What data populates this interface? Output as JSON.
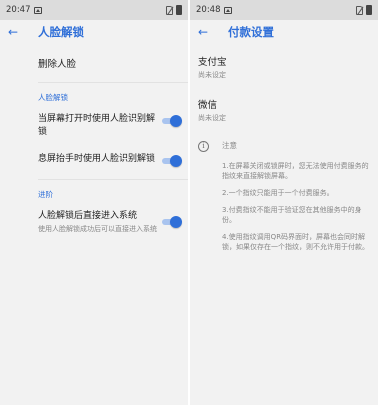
{
  "left": {
    "status": {
      "time": "20:47"
    },
    "title": "人脸解锁",
    "delete_label": "删除人脸",
    "section1": "人脸解锁",
    "toggle1": "当屏幕打开时使用人脸识别解锁",
    "toggle2": "息屏抬手时使用人脸识别解锁",
    "section2": "进阶",
    "toggle3": "人脸解锁后直接进入系统",
    "toggle3_sub": "使用人脸解锁成功后可以直接进入系统"
  },
  "right": {
    "status": {
      "time": "20:48"
    },
    "title": "付款设置",
    "items": [
      {
        "title": "支付宝",
        "subtitle": "尚未设定"
      },
      {
        "title": "微信",
        "subtitle": "尚未设定"
      }
    ],
    "note_title": "注意",
    "notes": [
      "1.在屏幕关闭或锁屏时，您无法使用付费服务的指纹来直接解锁屏幕。",
      "2.一个指纹只能用于一个付费服务。",
      "3.付费指纹不能用于验证您在其他服务中的身份。",
      "4.使用指纹调用QR码界面时，屏幕也会同时解锁，如果仅存在一个指纹，则不允许用于付款。"
    ]
  },
  "colors": {
    "accent": "#2f6fd8"
  },
  "icons": [
    "back-arrow-icon",
    "image-icon",
    "no-sim-icon",
    "battery-icon",
    "info-icon"
  ]
}
